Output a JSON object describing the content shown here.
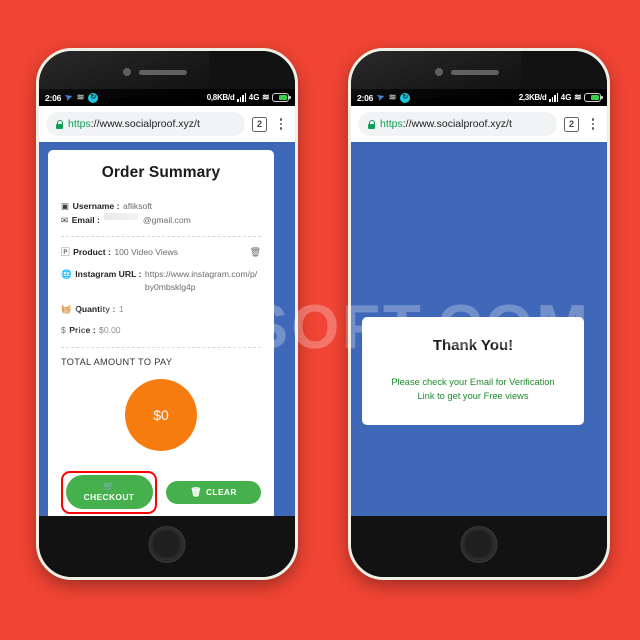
{
  "background": {
    "color": "#f04434"
  },
  "watermark": {
    "text": "AFLIKSOFT.COM"
  },
  "phones": {
    "left": {
      "status_bar": {
        "time": "2:06",
        "icons": [
          "telegram-plane-icon",
          "wifi-alt-icon",
          "sync-icon"
        ],
        "data_rate": "0,8KB/d",
        "network": "4G",
        "signal": "signal-bars-icon",
        "wifi": "wifi-icon",
        "battery": "battery-icon"
      },
      "browser": {
        "lock": "lock-icon",
        "url_scheme": "https",
        "url_rest": "://www.socialproof.xyz/t",
        "tab_count": "2",
        "menu": "kebab-menu-icon"
      },
      "page": {
        "title": "Order Summary",
        "fields": [
          {
            "icon": "instagram-icon",
            "label": "Username :",
            "value": "afliksoft",
            "redacted": false
          },
          {
            "icon": "envelope-icon",
            "label": "Email :",
            "value": "@gmail.com",
            "redacted": true
          },
          {
            "icon": "product-icon",
            "label": "Product :",
            "value": "100 Video Views",
            "redacted": false,
            "trash": "trash-icon"
          },
          {
            "icon": "globe-icon",
            "label": "Instagram URL :",
            "value": "https://www.instagram.com/p/by0mbsklg4p",
            "redacted": false
          },
          {
            "icon": "basket-icon",
            "label": "Quantity :",
            "value": "1",
            "redacted": false
          },
          {
            "icon": "dollar-icon",
            "label": "Price :",
            "value": "$0.00",
            "redacted": false
          }
        ],
        "total_label": "TOTAL AMOUNT TO PAY",
        "total_amount": "$0",
        "total_circle_color": "#f77c10",
        "buttons": {
          "checkout": "CHECKOUT",
          "checkout_icon": "shopping-cart-icon",
          "checkout_highlight_color": "#ff0000",
          "clear": "CLEAR",
          "clear_icon": "trash-icon",
          "button_color": "#46b14c"
        },
        "page_bg_color": "#4068b8"
      }
    },
    "right": {
      "status_bar": {
        "time": "2:06",
        "icons": [
          "telegram-plane-icon",
          "wifi-alt-icon",
          "sync-icon"
        ],
        "data_rate": "2,3KB/d",
        "network": "4G",
        "signal": "signal-bars-icon",
        "wifi": "wifi-icon",
        "battery": "battery-icon"
      },
      "browser": {
        "lock": "lock-icon",
        "url_scheme": "https",
        "url_rest": "://www.socialproof.xyz/t",
        "tab_count": "2",
        "menu": "kebab-menu-icon"
      },
      "page": {
        "title": "Thank You!",
        "message_line1": "Please check your Email for Verification",
        "message_line2": "Link to get your Free views",
        "message_color": "#1f8a2e",
        "page_bg_color": "#4068b8"
      }
    }
  }
}
